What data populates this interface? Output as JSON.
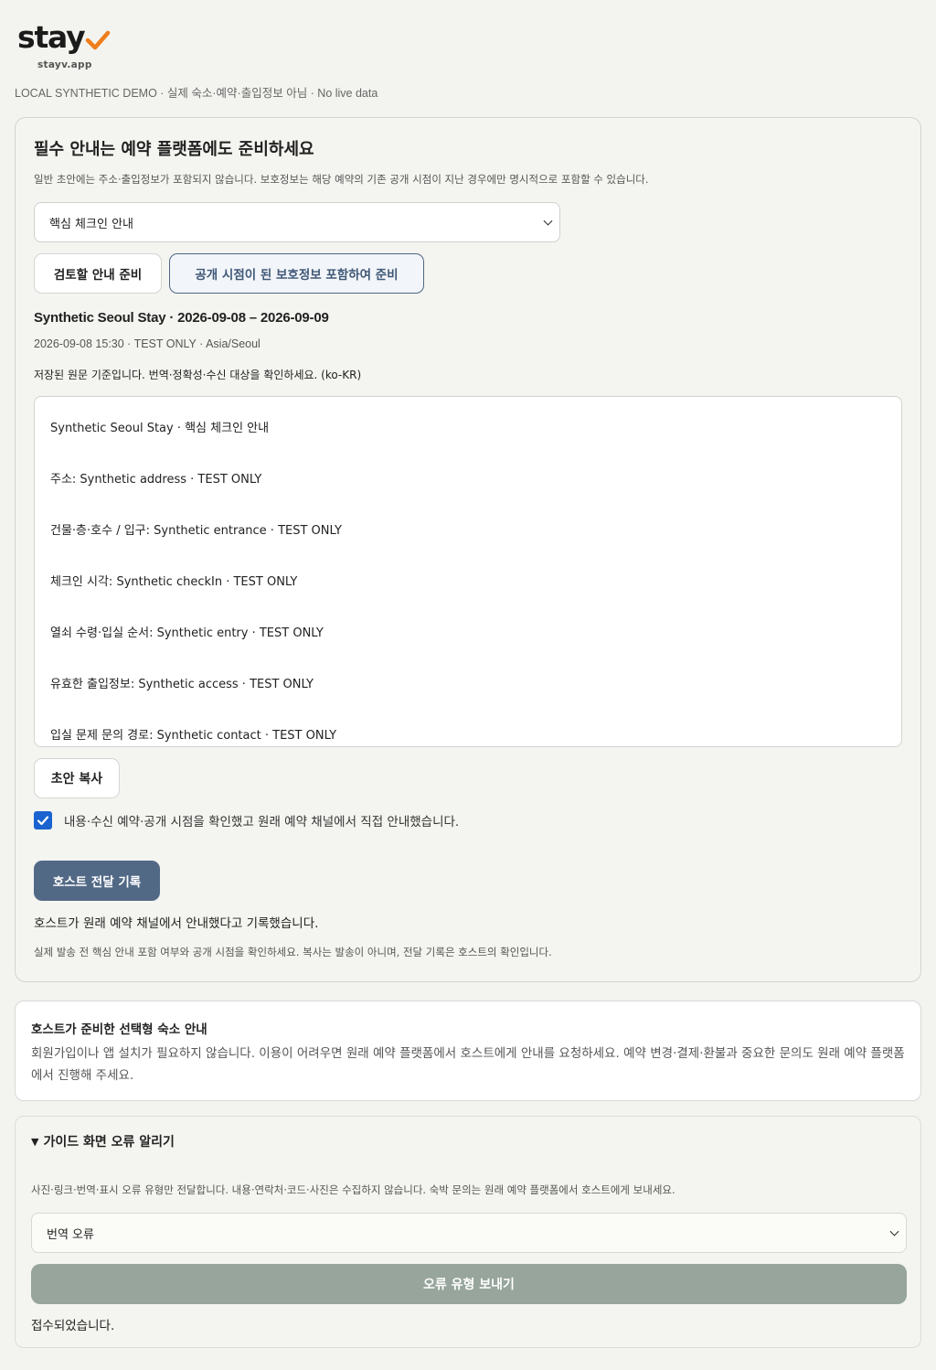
{
  "brand": {
    "logo_text": "stay",
    "domain": "stayv.app",
    "accent_color": "#f07d1c"
  },
  "demo_banner": "LOCAL SYNTHETIC DEMO · 실제 숙소·예약·출입정보 아님 · No live data",
  "main": {
    "title": "필수 안내는 예약 플랫폼에도 준비하세요",
    "description": "일반 초안에는 주소·출입정보가 포함되지 않습니다. 보호정보는 해당 예약의 기존 공개 시점이 지난 경우에만 명시적으로 포함할 수 있습니다.",
    "guide_select": {
      "selected": "핵심 체크인 안내"
    },
    "prepare_button": "검토할 안내 준비",
    "prepare_protected_button": "공개 시점이 된 보호정보 포함하여 준비",
    "stay_title": "Synthetic Seoul Stay · 2026-09-08 – 2026-09-09",
    "stay_meta": "2026-09-08 15:30 · TEST ONLY · Asia/Seoul",
    "source_note": "저장된 원문 기준입니다. 번역·정확성·수신 대상을 확인하세요. (ko-KR)",
    "draft_lines": [
      "Synthetic Seoul Stay · 핵심 체크인 안내",
      "주소: Synthetic address · TEST ONLY",
      "건물·층·호수 / 입구: Synthetic entrance · TEST ONLY",
      "체크인 시각: Synthetic checkIn · TEST ONLY",
      "열쇠 수령·입실 순서: Synthetic entry · TEST ONLY",
      "유효한 출입정보: Synthetic access · TEST ONLY",
      "입실 문제 문의 경로: Synthetic contact · TEST ONLY"
    ],
    "copy_button": "초안 복사",
    "confirm_checkbox": {
      "checked": true,
      "label": "내용·수신 예약·공개 시점을 확인했고 원래 예약 채널에서 직접 안내했습니다."
    },
    "record_button": "호스트 전달 기록",
    "record_status": "호스트가 원래 예약 채널에서 안내했다고 기록했습니다.",
    "record_note": "실제 발송 전 핵심 안내 포함 여부와 공개 시점을 확인하세요. 복사는 발송이 아니며, 전달 기록은 호스트의 확인입니다."
  },
  "guide": {
    "title": "호스트가 준비한 선택형 숙소 안내",
    "body": "회원가입이나 앱 설치가 필요하지 않습니다. 이용이 어려우면 원래 예약 플랫폼에서 호스트에게 안내를 요청하세요. 예약 변경·결제·환불과 중요한 문의도 원래 예약 플랫폼에서 진행해 주세요."
  },
  "report": {
    "summary": "가이드 화면 오류 알리기",
    "expanded": true,
    "description": "사진·링크·번역·표시 오류 유형만 전달합니다. 내용·연락처·코드·사진은 수집하지 않습니다. 숙박 문의는 원래 예약 플랫폼에서 호스트에게 보내세요.",
    "type_select": {
      "selected": "번역 오류"
    },
    "send_button": "오류 유형 보내기",
    "status": "접수되었습니다."
  }
}
